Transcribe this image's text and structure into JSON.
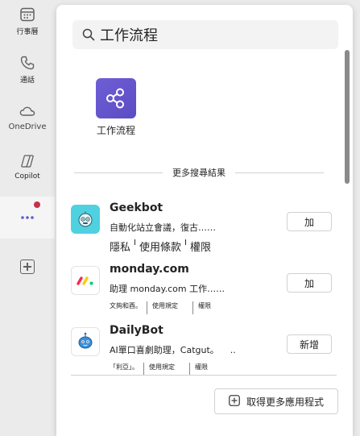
{
  "rail": {
    "items": [
      {
        "label": "行事曆",
        "icon": "calendar-icon"
      },
      {
        "label": "通話",
        "icon": "phone-icon"
      },
      {
        "label": "OneDrive",
        "icon": "cloud-icon"
      },
      {
        "label": "Copilot",
        "icon": "copilot-icon"
      },
      {
        "label": "",
        "icon": "more-apps-icon"
      }
    ],
    "add_icon": "add-app-icon"
  },
  "search": {
    "value": "工作流程",
    "icon": "search-icon"
  },
  "top_result": {
    "name": "工作流程",
    "icon": "workflow-icon",
    "tile_color": "#6656d0"
  },
  "section_label": "更多搜尋結果",
  "results": [
    {
      "title": "Geekbot",
      "desc": "自動化站立會議，復古……",
      "button": "加",
      "links": [
        "隱私",
        "使用條款",
        "權限"
      ],
      "links_seps": [
        "I",
        "I"
      ],
      "icon": "geekbot-icon"
    },
    {
      "title": "monday.com",
      "desc": "助理 monday.com 工作……",
      "button": "加",
      "links": [
        "文夠和酉。",
        "使用規定",
        "權限"
      ],
      "icon": "monday-icon"
    },
    {
      "title": "DailyBot",
      "desc": "AI單口喜劇助理，Catgut。",
      "desc_suffix": "..",
      "button": "新增",
      "links": [
        "「利亞」。",
        "使用規定",
        "權限"
      ],
      "icon": "dailybot-icon"
    }
  ],
  "more_button": {
    "label": "取得更多應用程式",
    "icon": "plus-square-icon"
  },
  "colors": {
    "accent": "#5b5fc7",
    "badge": "#c4314b",
    "panel": "#ffffff",
    "rail": "#ebebeb"
  }
}
